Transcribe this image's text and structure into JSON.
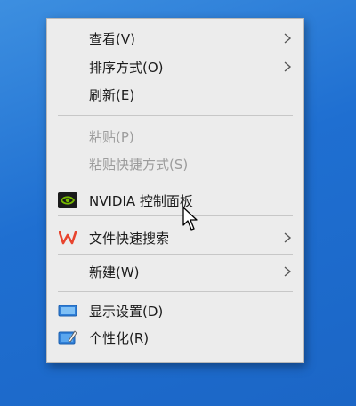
{
  "context_menu": {
    "items": [
      {
        "label": "查看(V)",
        "icon": null,
        "has_submenu": true,
        "enabled": true
      },
      {
        "label": "排序方式(O)",
        "icon": null,
        "has_submenu": true,
        "enabled": true
      },
      {
        "label": "刷新(E)",
        "icon": null,
        "has_submenu": false,
        "enabled": true
      },
      {
        "label": "粘贴(P)",
        "icon": null,
        "has_submenu": false,
        "enabled": false
      },
      {
        "label": "粘贴快捷方式(S)",
        "icon": null,
        "has_submenu": false,
        "enabled": false
      },
      {
        "label": "NVIDIA 控制面板",
        "icon": "nvidia-icon",
        "has_submenu": false,
        "enabled": true
      },
      {
        "label": "文件快速搜索",
        "icon": "wps-icon",
        "has_submenu": true,
        "enabled": true
      },
      {
        "label": "新建(W)",
        "icon": null,
        "has_submenu": true,
        "enabled": true
      },
      {
        "label": "显示设置(D)",
        "icon": "display-settings-icon",
        "has_submenu": false,
        "enabled": true
      },
      {
        "label": "个性化(R)",
        "icon": "personalize-icon",
        "has_submenu": false,
        "enabled": true
      }
    ]
  },
  "colors": {
    "desktop_background": "#1f6fd1",
    "menu_background": "#ececec",
    "disabled_text": "#9c9c9c",
    "nvidia_green": "#76b900",
    "wps_red": "#e8442e"
  }
}
